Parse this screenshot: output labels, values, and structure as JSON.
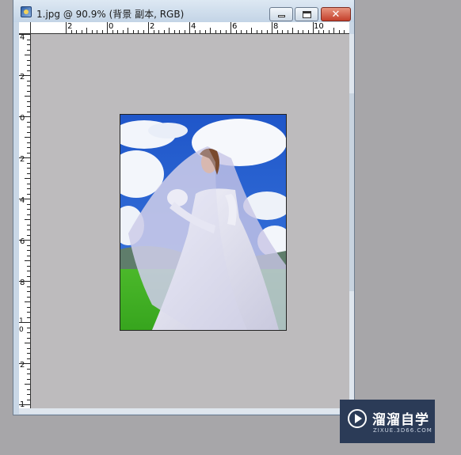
{
  "window": {
    "title": "1.jpg @ 90.9% (背景 副本, RGB)",
    "buttons": {
      "minimize": "minimize",
      "maximize": "maximize",
      "close": "✕"
    }
  },
  "rulers": {
    "horizontal_labels": [
      "2",
      "0",
      "2",
      "4",
      "6",
      "8",
      "10"
    ],
    "vertical_labels": [
      "4",
      "2",
      "0",
      "2",
      "4",
      "6",
      "8",
      "10",
      "2",
      "1"
    ]
  },
  "canvas": {
    "background": "#bdbbbd",
    "image_description_icon": "wedding-photo"
  },
  "watermark": {
    "brand": "溜溜自学",
    "url": "ZIXUE.3D66.COM",
    "icon": "play-icon",
    "background": "#2b3b57"
  }
}
